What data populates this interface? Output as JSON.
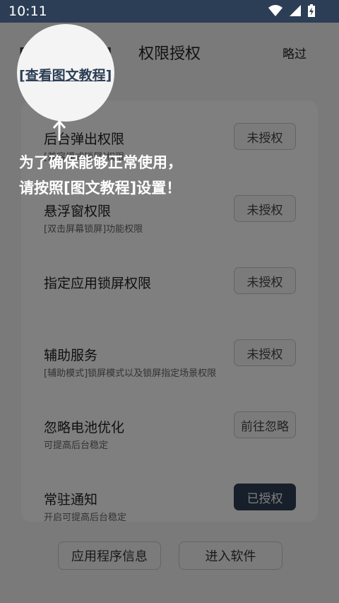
{
  "status_bar": {
    "time": "10:11",
    "icons": [
      "wifi-icon",
      "signal-icon",
      "battery-charging-icon"
    ]
  },
  "header": {
    "tutorial_link": "[查看图文教程]",
    "title": "权限授权",
    "skip": "略过"
  },
  "permissions": [
    {
      "title": "后台弹出权限",
      "desc": "[兼容模式锁屏]权限",
      "button": "未授权",
      "granted": false
    },
    {
      "title": "悬浮窗权限",
      "desc": "[双击屏幕锁屏]功能权限",
      "button": "未授权",
      "granted": false
    },
    {
      "title": "指定应用锁屏权限",
      "desc": "",
      "button": "未授权",
      "granted": false
    },
    {
      "title": "辅助服务",
      "desc": "[辅助模式]锁屏模式以及锁屏指定场景权限",
      "button": "未授权",
      "granted": false
    },
    {
      "title": "忽略电池优化",
      "desc": "可提高后台稳定",
      "button": "前往忽略",
      "granted": false
    },
    {
      "title": "常驻通知",
      "desc": "开启可提高后台稳定",
      "button": "已授权",
      "granted": true
    }
  ],
  "bottom": {
    "app_info": "应用程序信息",
    "enter": "进入软件"
  },
  "guide": {
    "line1": "为了确保能够正常使用，",
    "line2": "请按照[图文教程]设置！",
    "arrow_icon": "arrow-up-icon"
  },
  "colors": {
    "accent": "#2c3e55",
    "overlay": "rgba(0,0,0,0.5)"
  }
}
